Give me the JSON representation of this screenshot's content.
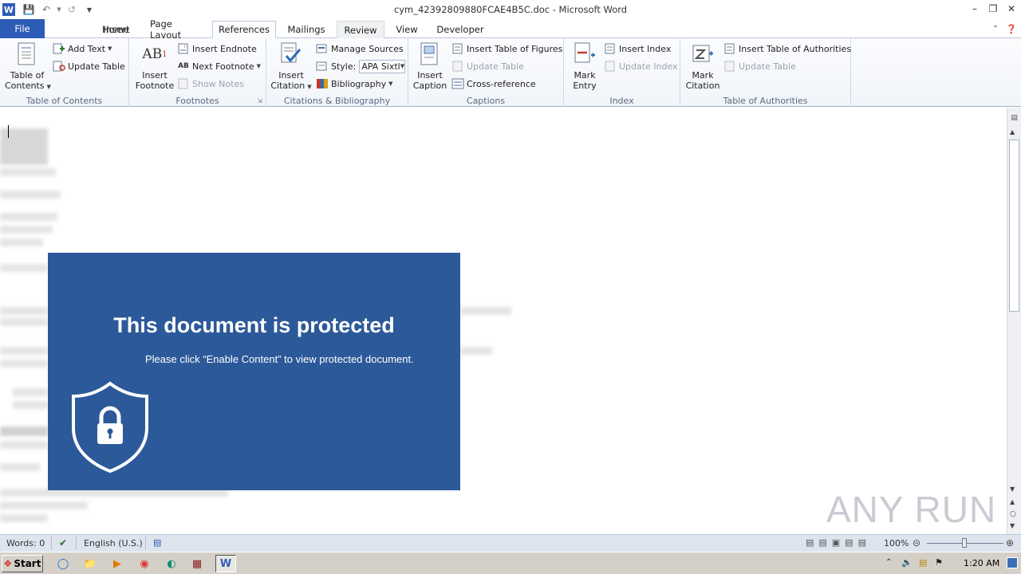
{
  "window": {
    "title": "cym_42392809880FCAE4B5C.doc - Microsoft Word"
  },
  "tabs": {
    "file": "File",
    "items": [
      "Home",
      "Insert",
      "Page Layout",
      "References",
      "Mailings",
      "Review",
      "View",
      "Developer"
    ],
    "active": "References"
  },
  "ribbon": {
    "toc": {
      "table_of_contents": "Table of\nContents",
      "add_text": "Add Text",
      "update_table": "Update Table",
      "label": "Table of Contents"
    },
    "footnotes": {
      "insert_footnote": "Insert\nFootnote",
      "insert_endnote": "Insert Endnote",
      "next_footnote": "Next Footnote",
      "show_notes": "Show Notes",
      "label": "Footnotes"
    },
    "citations": {
      "insert_citation": "Insert\nCitation",
      "manage_sources": "Manage Sources",
      "style_label": "Style:",
      "style_value": "APA Sixtl",
      "bibliography": "Bibliography",
      "label": "Citations & Bibliography"
    },
    "captions": {
      "insert_caption": "Insert\nCaption",
      "insert_table_of_figures": "Insert Table of Figures",
      "update_table": "Update Table",
      "cross_reference": "Cross-reference",
      "label": "Captions"
    },
    "index": {
      "mark_entry": "Mark\nEntry",
      "insert_index": "Insert Index",
      "update_index": "Update Index",
      "label": "Index"
    },
    "authorities": {
      "mark_citation": "Mark\nCitation",
      "insert_toa": "Insert Table of Authorities",
      "update_table": "Update Table",
      "label": "Table of Authorities"
    }
  },
  "document": {
    "banner_heading": "This document is protected",
    "banner_text": "Please click “Enable Content” to view protected document."
  },
  "status": {
    "words": "Words: 0",
    "language": "English (U.S.)",
    "zoom": "100%"
  },
  "taskbar": {
    "start": "Start",
    "clock": "1:20 AM"
  },
  "watermark": "ANY RUN",
  "colors": {
    "banner": "#2c5999",
    "file_tab": "#2d5cb6"
  }
}
